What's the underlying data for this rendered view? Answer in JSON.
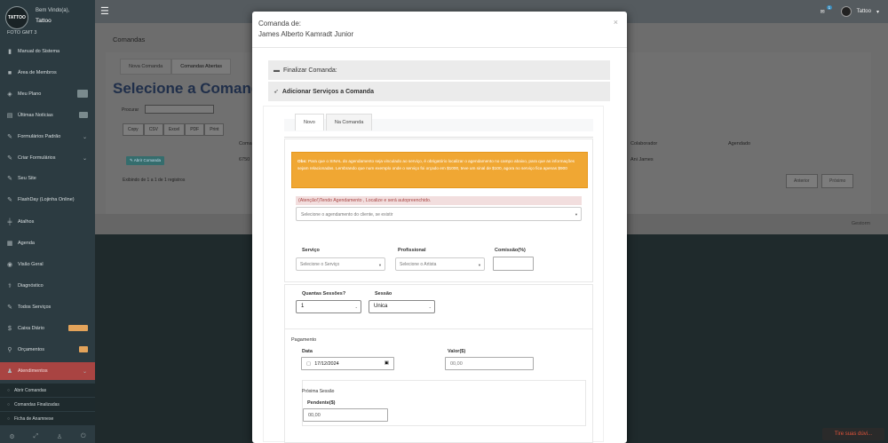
{
  "sidebar": {
    "logo_text": "TATTOO",
    "welcome": "Bem Vindo(a),",
    "user": "Tattoo",
    "foto": "FOTO  GMT  3",
    "items": [
      {
        "label": "Manual do Sistema",
        "icon": "book-icon"
      },
      {
        "label": "Área de Membros",
        "icon": "video-icon"
      },
      {
        "label": "Meu Plano",
        "icon": "diamond-icon"
      },
      {
        "label": "Últimas Notícias",
        "icon": "news-icon"
      },
      {
        "label": "Formulários Padrão",
        "icon": "wrench-icon"
      },
      {
        "label": "Criar Formulários",
        "icon": "wrench-icon"
      },
      {
        "label": "Seu Site",
        "icon": "wrench-icon"
      },
      {
        "label": "FlashDay (Lojinha Online)",
        "icon": "wrench-icon"
      },
      {
        "label": "Atalhos",
        "icon": "signpost-icon"
      },
      {
        "label": "Agenda",
        "icon": "calendar-icon"
      },
      {
        "label": "Visão Geral",
        "icon": "eye-icon"
      },
      {
        "label": "Diagnóstico",
        "icon": "stethoscope-icon"
      },
      {
        "label": "Todos Serviços",
        "icon": "wrench-icon"
      },
      {
        "label": "Caixa Diário",
        "icon": "dollar-icon"
      },
      {
        "label": "Orçamentos",
        "icon": "pin-icon"
      },
      {
        "label": "Atendimentos",
        "icon": "users-icon"
      }
    ],
    "sub_items": [
      "Abrir Comandas",
      "Comandas Finalizadas",
      "Ficha de Anamnese"
    ]
  },
  "header": {
    "user": "Tattoo",
    "badge": "1"
  },
  "background": {
    "title": "Comandas",
    "tabs": [
      "Nova Comanda",
      "Comandas Abertas"
    ],
    "heading": "Selecione a Comand",
    "search_label": "Procurar",
    "export_buttons": [
      "Copy",
      "CSV",
      "Excel",
      "PDF",
      "Print"
    ],
    "col_headers": {
      "colab": "Colaborador",
      "agendado": "Agendado",
      "comanda": "Coma"
    },
    "row": {
      "abrir": "✎ Abrir Comanda",
      "num": "6750",
      "colab": "Ani James"
    },
    "exibindo": "Exibindo de 1 a 1 de 1 registros",
    "pagination": [
      "Anterior",
      "Próximo"
    ],
    "footer": "Gestorm"
  },
  "modal": {
    "title_line1": "Comanda de:",
    "title_line2": "James Alberto Kamradt Junior",
    "close": "×",
    "finalizar": "Finalizar Comanda:",
    "adicionar": "Adicionar Serviços a Comanda",
    "tabs": [
      "Novo",
      "Na Comanda"
    ],
    "alert_bold": "Obs:",
    "alert_text": "Para que o SINAL do agendamento seja vinculado ao serviço, é obrigatório localizar o agendamento no campo abaixo, para que as informações sejam relacionadas. Lembrando que num exemplo onde o serviço foi orçado em $1000, teve um sinal de $100, agora no serviço fica apenas $900",
    "warn_label": "(Atenção!)Tendo Agendamento , Localize e será autopreenchido.",
    "agendamento_placeholder": "Selecione o agendamento do cliente, se existir",
    "servico_label": "Serviço",
    "servico_placeholder": "Selecione o Serviço",
    "profissional_label": "Profissional",
    "profissional_placeholder": "Selecione o Artista",
    "comissao_label": "Comissão(%)",
    "sessoes_label": "Quantas Sessões?",
    "sessoes_value": "1",
    "sessao_label": "Sessão",
    "sessao_value": "Unica",
    "pagamento_label": "Pagamento",
    "data_label": "Data",
    "data_value": "17/12/2024",
    "valor_label": "Valor($)",
    "valor_placeholder": "00,00",
    "proxima_label": "Próxima Sessão",
    "pendente_label": "Pendente($)",
    "pendente_value": "00,00"
  },
  "toast": "Tire suas dúvi..."
}
